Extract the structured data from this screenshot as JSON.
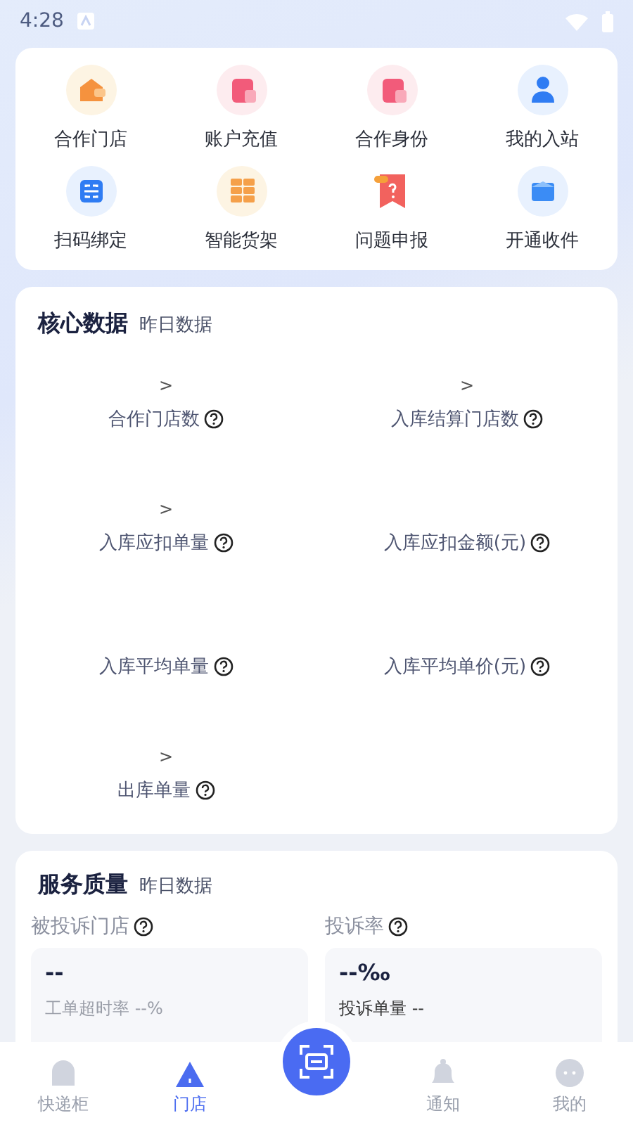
{
  "status_bar": {
    "time": "4:28"
  },
  "shortcuts": [
    {
      "label": "合作门店",
      "kind": "wallet"
    },
    {
      "label": "账户充值",
      "kind": "redbag"
    },
    {
      "label": "合作身份",
      "kind": "redbag"
    },
    {
      "label": "我的入站",
      "kind": "person"
    },
    {
      "label": "扫码绑定",
      "kind": "scan"
    },
    {
      "label": "智能货架",
      "kind": "shelf"
    },
    {
      "label": "问题申报",
      "kind": "report"
    },
    {
      "label": "开通收件",
      "kind": "box"
    }
  ],
  "core_data": {
    "title": "核心数据",
    "subtitle": "昨日数据",
    "metrics": [
      {
        "arrow": ">",
        "label": "合作门店数"
      },
      {
        "arrow": ">",
        "label": "入库结算门店数"
      },
      {
        "arrow": ">",
        "label": "入库应扣单量"
      },
      {
        "label": "入库应扣金额(元)"
      },
      {
        "label": "入库平均单量"
      },
      {
        "label": "入库平均单价(元)"
      },
      {
        "arrow": ">",
        "label": "出库单量"
      }
    ]
  },
  "service_quality": {
    "title": "服务质量",
    "subtitle": "昨日数据",
    "panels": [
      {
        "label": "被投诉门店",
        "value": "--",
        "note": "工单超时率 --%",
        "note_dark": false
      },
      {
        "label": "投诉率",
        "value": "--‰",
        "note": "投诉单量 --",
        "note_dark": true
      }
    ]
  },
  "tab_bar": [
    {
      "label": "快递柜",
      "kind": "locker",
      "selected": false
    },
    {
      "label": "门店",
      "kind": "store",
      "selected": true
    },
    {
      "kind": "scan"
    },
    {
      "label": "通知",
      "kind": "bell",
      "selected": false
    },
    {
      "label": "我的",
      "kind": "chat",
      "selected": false
    }
  ]
}
